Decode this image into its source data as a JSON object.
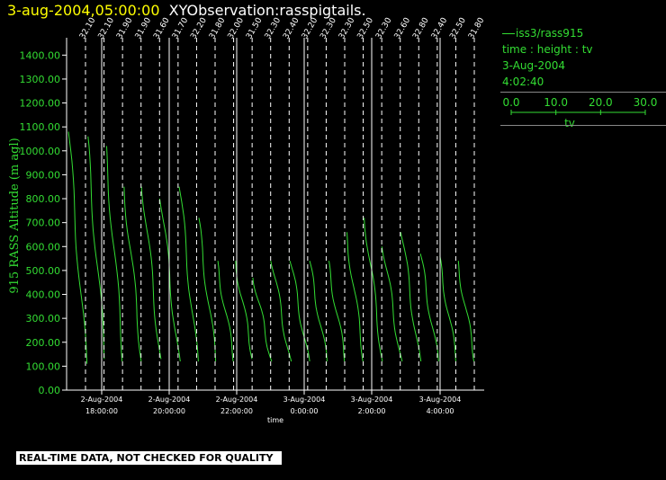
{
  "header": {
    "date_label": "3-aug-2004,05:00:00",
    "obs_label": "XYObservation:rasspigtails."
  },
  "legend": {
    "series_name": "iss3/rass915",
    "fields": "time : height : tv",
    "date": "3-Aug-2004",
    "time": "4:02:40",
    "scale_ticks": [
      "0.0",
      "10.0",
      "20.0",
      "30.0"
    ],
    "scale_label": "tv",
    "color": "#33dd33"
  },
  "footer": {
    "quality_notice": "REAL-TIME DATA, NOT CHECKED FOR QUALITY"
  },
  "chart_data": {
    "type": "line",
    "title": "",
    "xlabel": "time",
    "ylabel": "915 RASS Altitude (m agl)",
    "ylim": [
      0,
      1450
    ],
    "y_ticks": [
      0,
      100,
      200,
      300,
      400,
      500,
      600,
      700,
      800,
      900,
      1000,
      1100,
      1200,
      1300,
      1400
    ],
    "xlim_hours": [
      17.0,
      5.0
    ],
    "x_tick_labels": [
      {
        "date": "2-Aug-2004",
        "time": "18:00:00"
      },
      {
        "date": "2-Aug-2004",
        "time": "20:00:00"
      },
      {
        "date": "2-Aug-2004",
        "time": "22:00:00"
      },
      {
        "date": "3-Aug-2004",
        "time": "0:00:00"
      },
      {
        "date": "3-Aug-2004",
        "time": "2:00:00"
      },
      {
        "date": "3-Aug-2004",
        "time": "4:00:00"
      }
    ],
    "profile_labels": [
      "32.10",
      "32.10",
      "31.90",
      "31.90",
      "31.60",
      "31.70",
      "32.20",
      "31.80",
      "32.00",
      "31.50",
      "32.30",
      "32.40",
      "32.20",
      "32.30",
      "32.30",
      "32.50",
      "32.30",
      "32.60",
      "32.80",
      "32.40",
      "32.50",
      "31.80"
    ],
    "profiles": [
      {
        "hmax": 1080,
        "hmin": 110
      },
      {
        "hmax": 1060,
        "hmin": 130
      },
      {
        "hmax": 1020,
        "hmin": 120
      },
      {
        "hmax": 850,
        "hmin": 120
      },
      {
        "hmax": 850,
        "hmin": 130
      },
      {
        "hmax": 800,
        "hmin": 120
      },
      {
        "hmax": 850,
        "hmin": 120
      },
      {
        "hmax": 720,
        "hmin": 120
      },
      {
        "hmax": 540,
        "hmin": 120
      },
      {
        "hmax": 540,
        "hmin": 130
      },
      {
        "hmax": 470,
        "hmin": 120
      },
      {
        "hmax": 540,
        "hmin": 120
      },
      {
        "hmax": 540,
        "hmin": 120
      },
      {
        "hmax": 540,
        "hmin": 120
      },
      {
        "hmax": 540,
        "hmin": 120
      },
      {
        "hmax": 660,
        "hmin": 120
      },
      {
        "hmax": 720,
        "hmin": 120
      },
      {
        "hmax": 600,
        "hmin": 120
      },
      {
        "hmax": 660,
        "hmin": 120
      },
      {
        "hmax": 570,
        "hmin": 120
      },
      {
        "hmax": 560,
        "hmin": 120
      },
      {
        "hmax": 540,
        "hmin": 120
      }
    ],
    "series_color": "#33dd33",
    "grid": false
  }
}
